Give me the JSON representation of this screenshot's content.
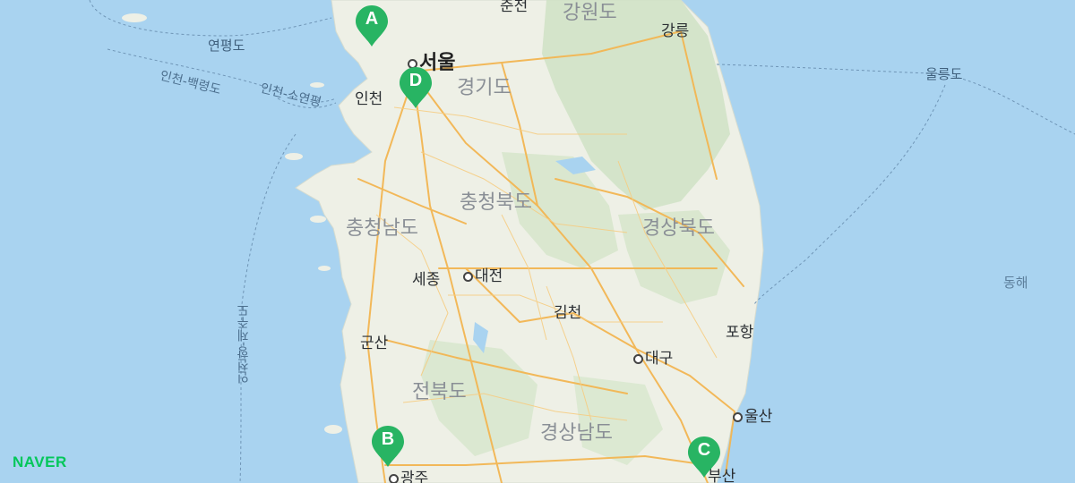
{
  "map": {
    "provinces": [
      "강원도",
      "경기도",
      "충청북도",
      "충청남도",
      "경상북도",
      "전북도",
      "경상남도"
    ],
    "cities": [
      "서울",
      "인천",
      "세종",
      "대전",
      "김천",
      "군산",
      "대구",
      "포항",
      "울산",
      "광주",
      "부산",
      "강릉",
      "춘천"
    ],
    "islands": [
      "연평도",
      "울릉도"
    ],
    "sea": [
      "동해"
    ],
    "routes": [
      "인천-백령도",
      "인천-소연평",
      "인천항-제주도"
    ],
    "markers": [
      "A",
      "B",
      "C",
      "D"
    ],
    "logo": "NAVER",
    "colors": {
      "sea": "#a9d3f0",
      "land": "#eef0e6",
      "mountain": "#cfe2c4",
      "road": "#f3b652",
      "marker": "#28b463"
    }
  }
}
